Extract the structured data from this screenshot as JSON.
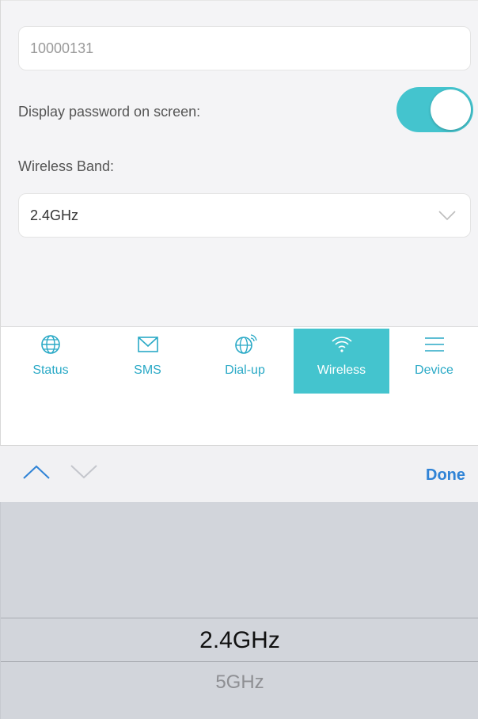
{
  "form": {
    "password_value": "10000131",
    "display_password_label": "Display password on screen:",
    "display_password_on": true,
    "wireless_band_label": "Wireless Band:",
    "wireless_band_value": "2.4GHz"
  },
  "tabs": [
    {
      "label": "Status",
      "icon": "globe-icon",
      "active": false
    },
    {
      "label": "SMS",
      "icon": "envelope-icon",
      "active": false
    },
    {
      "label": "Dial-up",
      "icon": "globe-signal-icon",
      "active": false
    },
    {
      "label": "Wireless",
      "icon": "wifi-icon",
      "active": true
    },
    {
      "label": "Device",
      "icon": "menu-icon",
      "active": false
    }
  ],
  "keyboard_accessory": {
    "done_label": "Done"
  },
  "picker": {
    "options": [
      "2.4GHz",
      "5GHz"
    ],
    "selected": "2.4GHz"
  },
  "colors": {
    "accent": "#44c4ce",
    "tab_text": "#29a9c6",
    "done": "#2f83d6"
  }
}
